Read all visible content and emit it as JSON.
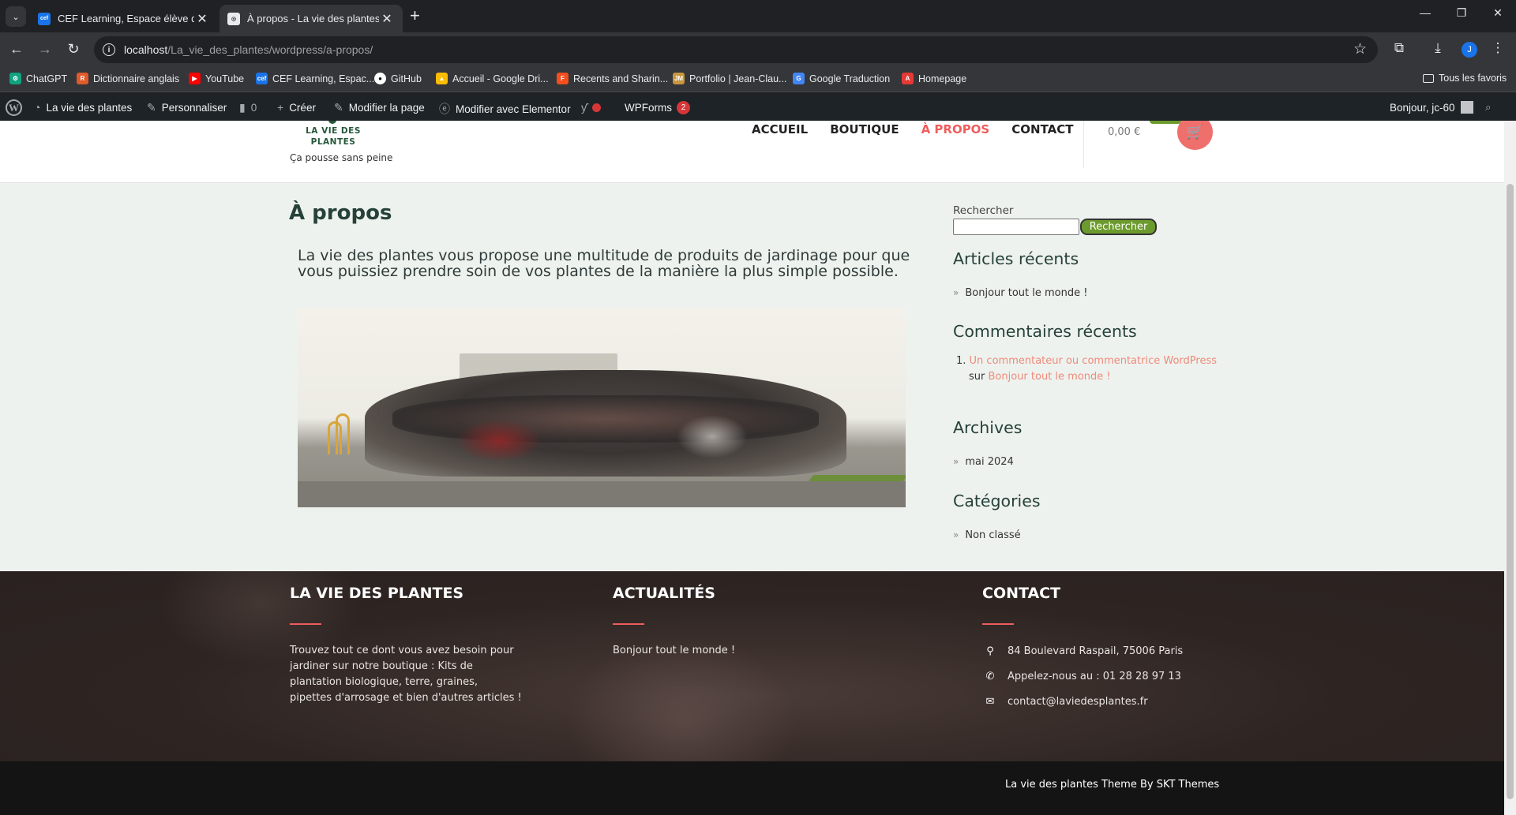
{
  "browser": {
    "tabs": [
      {
        "title": "CEF Learning, Espace élève du C",
        "icon": "cef-favicon",
        "color": "#1a73e8"
      },
      {
        "title": "À propos - La vie des plantes",
        "icon": "page-favicon",
        "color": "#5f6368"
      }
    ],
    "url_host": "localhost",
    "url_path": "/La_vie_des_plantes/wordpress/a-propos/",
    "profile_initial": "J",
    "bookmarks": [
      {
        "label": "ChatGPT",
        "icon": "chatgpt-icon",
        "color": "#10a37f"
      },
      {
        "label": "Dictionnaire anglais",
        "icon": "dictionary-icon",
        "color": "#e05a2b"
      },
      {
        "label": "YouTube",
        "icon": "youtube-icon",
        "color": "#ff0000"
      },
      {
        "label": "CEF Learning, Espac...",
        "icon": "cef-icon",
        "color": "#1a73e8"
      },
      {
        "label": "GitHub",
        "icon": "github-icon",
        "color": "#ffffff"
      },
      {
        "label": "Accueil - Google Dri...",
        "icon": "google-drive-icon",
        "color": "#fbbc04"
      },
      {
        "label": "Recents and Sharin...",
        "icon": "figma-icon",
        "color": "#f24e1e"
      },
      {
        "label": "Portfolio | Jean-Clau...",
        "icon": "portfolio-icon",
        "color": "#c8963e"
      },
      {
        "label": "Google Traduction",
        "icon": "google-translate-icon",
        "color": "#4285f4"
      },
      {
        "label": "Homepage",
        "icon": "homepage-icon",
        "color": "#e53935"
      }
    ],
    "all_bookmarks": "Tous les favoris"
  },
  "wp_admin_bar": {
    "site_name": "La vie des plantes",
    "customize": "Personnaliser",
    "comments_count": "0",
    "new": "Créer",
    "edit_page": "Modifier la page",
    "edit_elementor": "Modifier avec Elementor",
    "wpforms": "WPForms",
    "wpforms_badge": "2",
    "greeting": "Bonjour, jc-60"
  },
  "site": {
    "logo_line1": "LA VIE DES",
    "logo_line2": "PLANTES",
    "tagline": "Ça pousse sans peine",
    "nav": [
      "ACCUEIL",
      "BOUTIQUE",
      "À PROPOS",
      "CONTACT"
    ],
    "cart_total": "0,00 €",
    "accent": "#ef5d5d",
    "green": "#6c9b2d"
  },
  "main": {
    "title": "À propos",
    "intro": "La vie des plantes vous propose une multitude de produits de jardinage pour que vous puissiez prendre soin de vos plantes de la manière la plus simple possible."
  },
  "sidebar": {
    "search_label": "Rechercher",
    "search_button": "Rechercher",
    "recent_posts_title": "Articles récents",
    "recent_posts": [
      "Bonjour tout le monde !"
    ],
    "recent_comments_title": "Commentaires récents",
    "comment_author": "Un commentateur ou commentatrice WordPress",
    "comment_on": "sur",
    "comment_post": "Bonjour tout le monde !",
    "archives_title": "Archives",
    "archives": [
      "mai 2024"
    ],
    "categories_title": "Catégories",
    "categories": [
      "Non classé"
    ]
  },
  "footer": {
    "col1_title": "LA VIE DES PLANTES",
    "col1_text": "Trouvez tout ce dont vous avez besoin pour jardiner sur notre boutique : Kits de plantation biologique, terre, graines, pipettes d'arrosage et bien d'autres articles !",
    "col2_title": "ACTUALITÉS",
    "col2_link": "Bonjour tout le monde !",
    "col3_title": "CONTACT",
    "address": "84 Boulevard Raspail, 75006 Paris",
    "phone": "Appelez-nous au : 01 28 28 97 13",
    "email": "contact@laviedesplantes.fr",
    "copyright": "La vie des plantes Theme By SKT Themes"
  }
}
